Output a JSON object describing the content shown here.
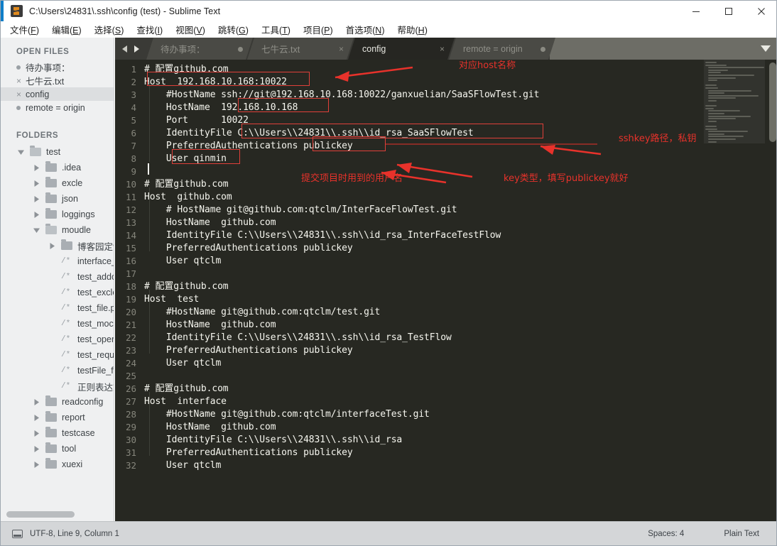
{
  "window": {
    "title": "C:\\Users\\24831\\.ssh\\config (test) - Sublime Text",
    "icon": "sublime-text-icon",
    "controls": {
      "minimize": "minimize-icon",
      "maximize": "maximize-icon",
      "close": "close-icon"
    }
  },
  "menubar": {
    "items": [
      {
        "label": "文件(F)"
      },
      {
        "label": "编辑(E)"
      },
      {
        "label": "选择(S)"
      },
      {
        "label": "查找(I)"
      },
      {
        "label": "视图(V)"
      },
      {
        "label": "跳转(G)"
      },
      {
        "label": "工具(T)"
      },
      {
        "label": "项目(P)"
      },
      {
        "label": "首选项(N)"
      },
      {
        "label": "帮助(H)"
      }
    ]
  },
  "sidebar": {
    "open_files_title": "OPEN FILES",
    "open_files": [
      {
        "label": "待办事项：",
        "mark": "dot",
        "selected": false
      },
      {
        "label": "七牛云.txt",
        "mark": "close",
        "selected": false
      },
      {
        "label": "config",
        "mark": "close",
        "selected": true
      },
      {
        "label": "remote = origin",
        "mark": "dot",
        "selected": false
      }
    ],
    "folders_title": "FOLDERS",
    "tree": [
      {
        "label": "test",
        "indent": 0,
        "type": "folder",
        "expanded": true
      },
      {
        "label": ".idea",
        "indent": 1,
        "type": "folder",
        "expanded": false
      },
      {
        "label": "excle",
        "indent": 1,
        "type": "folder",
        "expanded": false
      },
      {
        "label": "json",
        "indent": 1,
        "type": "folder",
        "expanded": false
      },
      {
        "label": "loggings",
        "indent": 1,
        "type": "folder",
        "expanded": false
      },
      {
        "label": "moudle",
        "indent": 1,
        "type": "folder",
        "expanded": true
      },
      {
        "label": "博客园定制模板",
        "indent": 2,
        "type": "folder",
        "expanded": false
      },
      {
        "label": "interface_bing",
        "indent": 2,
        "type": "file"
      },
      {
        "label": "test_addorder.",
        "indent": 2,
        "type": "file"
      },
      {
        "label": "test_excle_dao",
        "indent": 2,
        "type": "file"
      },
      {
        "label": "test_file.py",
        "indent": 2,
        "type": "file"
      },
      {
        "label": "test_mock.py",
        "indent": 2,
        "type": "file"
      },
      {
        "label": "test_operation",
        "indent": 2,
        "type": "file"
      },
      {
        "label": "test_requests.",
        "indent": 2,
        "type": "file"
      },
      {
        "label": "testFile_form_",
        "indent": 2,
        "type": "file"
      },
      {
        "label": "正则表达式.py",
        "indent": 2,
        "type": "file"
      },
      {
        "label": "readconfig",
        "indent": 1,
        "type": "folder",
        "expanded": false
      },
      {
        "label": "report",
        "indent": 1,
        "type": "folder",
        "expanded": false
      },
      {
        "label": "testcase",
        "indent": 1,
        "type": "folder",
        "expanded": false
      },
      {
        "label": "tool",
        "indent": 1,
        "type": "folder",
        "expanded": false
      },
      {
        "label": "xuexi",
        "indent": 1,
        "type": "folder",
        "expanded": false
      }
    ]
  },
  "tabs": [
    {
      "label": "待办事项：",
      "active": false,
      "mark": "dot"
    },
    {
      "label": "七牛云.txt",
      "active": false,
      "mark": "close"
    },
    {
      "label": "config",
      "active": true,
      "mark": "close"
    },
    {
      "label": "remote = origin",
      "active": false,
      "mark": "dot"
    }
  ],
  "tab_overflow_icon": "chevron-down-icon",
  "editor": {
    "lines": [
      {
        "n": 1,
        "text": "# 配置github.com"
      },
      {
        "n": 2,
        "text": "Host  192.168.10.168:10022"
      },
      {
        "n": 3,
        "text": "    #HostName ssh://git@192.168.10.168:10022/ganxuelian/SaaSFlowTest.git"
      },
      {
        "n": 4,
        "text": "    HostName  192.168.10.168"
      },
      {
        "n": 5,
        "text": "    Port      10022"
      },
      {
        "n": 6,
        "text": "    IdentityFile C:\\\\Users\\\\24831\\\\.ssh\\\\id_rsa_SaaSFlowTest"
      },
      {
        "n": 7,
        "text": "    PreferredAuthentications publickey"
      },
      {
        "n": 8,
        "text": "    User qinmin"
      },
      {
        "n": 9,
        "text": ""
      },
      {
        "n": 10,
        "text": "# 配置github.com"
      },
      {
        "n": 11,
        "text": "Host  github.com"
      },
      {
        "n": 12,
        "text": "    # HostName git@github.com:qtclm/InterFaceFlowTest.git"
      },
      {
        "n": 13,
        "text": "    HostName  github.com"
      },
      {
        "n": 14,
        "text": "    IdentityFile C:\\\\Users\\\\24831\\\\.ssh\\\\id_rsa_InterFaceTestFlow"
      },
      {
        "n": 15,
        "text": "    PreferredAuthentications publickey"
      },
      {
        "n": 16,
        "text": "    User qtclm"
      },
      {
        "n": 17,
        "text": ""
      },
      {
        "n": 18,
        "text": "# 配置github.com"
      },
      {
        "n": 19,
        "text": "Host  test"
      },
      {
        "n": 20,
        "text": "    #HostName git@github.com:qtclm/test.git"
      },
      {
        "n": 21,
        "text": "    HostName  github.com"
      },
      {
        "n": 22,
        "text": "    IdentityFile C:\\\\Users\\\\24831\\\\.ssh\\\\id_rsa_TestFlow"
      },
      {
        "n": 23,
        "text": "    PreferredAuthentications publickey"
      },
      {
        "n": 24,
        "text": "    User qtclm"
      },
      {
        "n": 25,
        "text": ""
      },
      {
        "n": 26,
        "text": "# 配置github.com"
      },
      {
        "n": 27,
        "text": "Host  interface"
      },
      {
        "n": 28,
        "text": "    #HostName git@github.com:qtclm/interfaceTest.git"
      },
      {
        "n": 29,
        "text": "    HostName  github.com"
      },
      {
        "n": 30,
        "text": "    IdentityFile C:\\\\Users\\\\24831\\\\.ssh\\\\id_rsa"
      },
      {
        "n": 31,
        "text": "    PreferredAuthentications publickey"
      },
      {
        "n": 32,
        "text": "    User qtclm"
      }
    ]
  },
  "annotations": {
    "color": "#e8322b",
    "notes": [
      {
        "id": "note-host-name",
        "text": "对应host名称"
      },
      {
        "id": "note-sshkey-path",
        "text": "sshkey路径，私钥"
      },
      {
        "id": "note-username",
        "text": "提交项目时用到的用户名"
      },
      {
        "id": "note-keytype",
        "text": "key类型，填写publickey就好"
      }
    ]
  },
  "statusbar": {
    "icon": "save-state-icon",
    "left": "UTF-8, Line 9, Column 1",
    "indent": "Spaces: 4",
    "syntax": "Plain Text"
  }
}
